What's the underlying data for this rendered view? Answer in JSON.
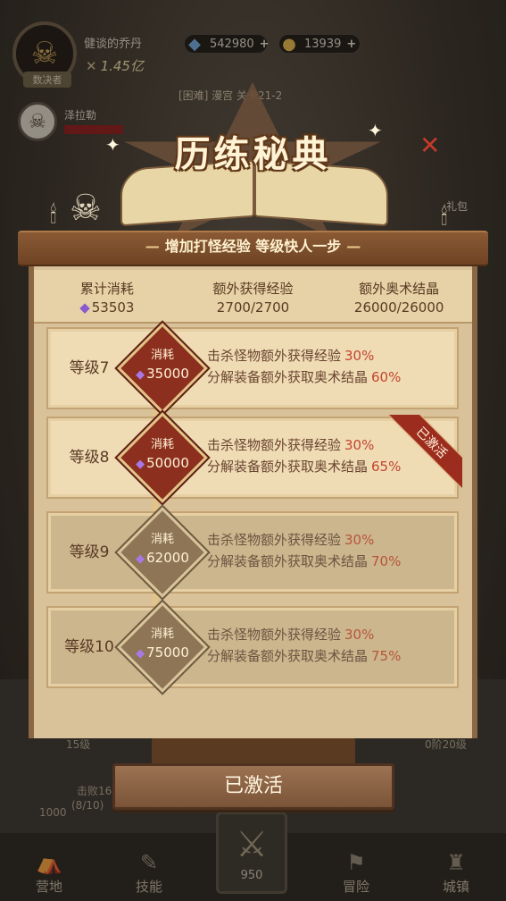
{
  "hud": {
    "player_name": "健谈的乔丹",
    "rank_tag": "数决者",
    "power": "1.45亿",
    "gems": "542980",
    "coins": "13939",
    "boss_name": "泽拉勒",
    "stage": "[困难] 漫宫 关卡21-2",
    "side_label": "礼包"
  },
  "background": {
    "left_label": "15级",
    "right_label": "0阶20级",
    "quest_label": "击败16",
    "quest_progress": "(8/10)",
    "quest_reward": "1000"
  },
  "bottom_nav": {
    "items": [
      "营地",
      "技能",
      "冒险",
      "城镇"
    ],
    "center_value": "950"
  },
  "modal": {
    "title": "历练秘典",
    "subtitle": "增加打怪经验 等级快人一步",
    "summary": {
      "cols": [
        {
          "label": "累计消耗",
          "value": "53503"
        },
        {
          "label": "额外获得经验",
          "value": "2700/2700"
        },
        {
          "label": "额外奥术结晶",
          "value": "26000/26000"
        }
      ]
    },
    "rows": [
      {
        "level": "等级7",
        "cost_label": "消耗",
        "cost": "35000",
        "line1": "击杀怪物额外获得经验",
        "pct1": "30%",
        "line2": "分解装备额外获取奥术结晶",
        "pct2": "60%"
      },
      {
        "level": "等级8",
        "cost_label": "消耗",
        "cost": "50000",
        "line1": "击杀怪物额外获得经验",
        "pct1": "30%",
        "line2": "分解装备额外获取奥术结晶",
        "pct2": "65%",
        "badge": "已激活"
      },
      {
        "level": "等级9",
        "cost_label": "消耗",
        "cost": "62000",
        "line1": "击杀怪物额外获得经验",
        "pct1": "30%",
        "line2": "分解装备额外获取奥术结晶",
        "pct2": "70%"
      },
      {
        "level": "等级10",
        "cost_label": "消耗",
        "cost": "75000",
        "line1": "击杀怪物额外获得经验",
        "pct1": "30%",
        "line2": "分解装备额外获取奥术结晶",
        "pct2": "75%"
      }
    ],
    "button_label": "已激活"
  },
  "icons": {
    "gem": "gem-icon",
    "coin": "coin-icon",
    "skull": "skull-icon",
    "close": "close-icon"
  },
  "colors": {
    "cost_red": "#8c2f1e",
    "pct_red": "#c4442e",
    "parchment": "#efdcb5"
  }
}
